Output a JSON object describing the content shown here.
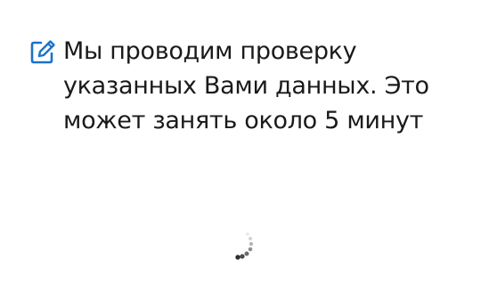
{
  "notice": {
    "icon": "edit-icon",
    "message": "Мы проводим проверку указанных Вами данных. Это может занять около 5 минут",
    "accent_color": "#1b73c9",
    "text_color": "#1a1a1a"
  },
  "loader": {
    "icon": "loading-spinner-icon",
    "color": "#333333"
  }
}
